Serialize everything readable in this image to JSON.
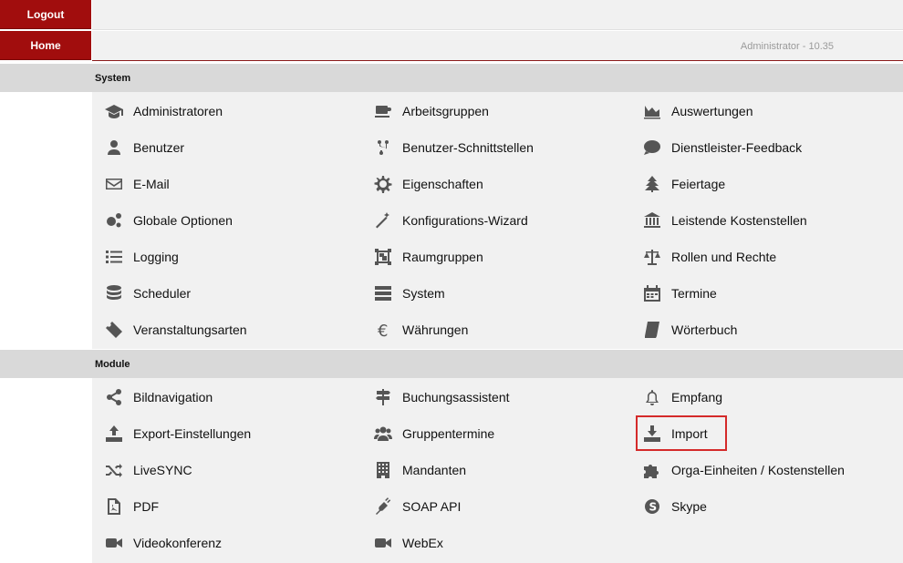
{
  "nav": {
    "logout": "Logout",
    "home": "Home"
  },
  "header": {
    "admin_info": "Administrator - 10.35"
  },
  "sections": {
    "system": {
      "title": "System",
      "items": [
        {
          "label": "Administratoren",
          "icon": "graduation-cap-icon"
        },
        {
          "label": "Arbeitsgruppen",
          "icon": "coffee-cup-icon"
        },
        {
          "label": "Auswertungen",
          "icon": "area-chart-icon"
        },
        {
          "label": "Benutzer",
          "icon": "user-icon"
        },
        {
          "label": "Benutzer-Schnittstellen",
          "icon": "code-fork-icon"
        },
        {
          "label": "Dienstleister-Feedback",
          "icon": "comment-dots-icon"
        },
        {
          "label": "E-Mail",
          "icon": "envelope-icon"
        },
        {
          "label": "Eigenschaften",
          "icon": "gear-icon"
        },
        {
          "label": "Feiertage",
          "icon": "tree-icon"
        },
        {
          "label": "Globale Optionen",
          "icon": "gears-icon"
        },
        {
          "label": "Konfigurations-Wizard",
          "icon": "magic-wand-icon"
        },
        {
          "label": "Leistende Kostenstellen",
          "icon": "bank-icon"
        },
        {
          "label": "Logging",
          "icon": "list-icon"
        },
        {
          "label": "Raumgruppen",
          "icon": "object-group-icon"
        },
        {
          "label": "Rollen und Rechte",
          "icon": "balance-scale-icon"
        },
        {
          "label": "Scheduler",
          "icon": "database-icon"
        },
        {
          "label": "System",
          "icon": "server-icon"
        },
        {
          "label": "Termine",
          "icon": "calendar-icon"
        },
        {
          "label": "Veranstaltungsarten",
          "icon": "ticket-icon"
        },
        {
          "label": "Währungen",
          "icon": "euro-icon"
        },
        {
          "label": "Wörterbuch",
          "icon": "book-icon"
        }
      ]
    },
    "module": {
      "title": "Module",
      "items": [
        {
          "label": "Bildnavigation",
          "icon": "share-nodes-icon"
        },
        {
          "label": "Buchungsassistent",
          "icon": "signpost-icon"
        },
        {
          "label": "Empfang",
          "icon": "bell-icon"
        },
        {
          "label": "Export-Einstellungen",
          "icon": "upload-icon"
        },
        {
          "label": "Gruppentermine",
          "icon": "users-icon"
        },
        {
          "label": "Import",
          "icon": "download-icon"
        },
        {
          "label": "LiveSYNC",
          "icon": "shuffle-icon"
        },
        {
          "label": "Mandanten",
          "icon": "building-icon"
        },
        {
          "label": "Orga-Einheiten / Kostenstellen",
          "icon": "puzzle-icon"
        },
        {
          "label": "PDF",
          "icon": "file-pdf-icon"
        },
        {
          "label": "SOAP API",
          "icon": "plug-icon"
        },
        {
          "label": "Skype",
          "icon": "skype-icon"
        },
        {
          "label": "Videokonferenz",
          "icon": "video-camera-icon"
        },
        {
          "label": "WebEx",
          "icon": "video-camera-icon"
        }
      ]
    }
  },
  "colors": {
    "brand": "#a10d0d",
    "highlight": "#d42a2a",
    "icon": "#555555",
    "section": "#d9d9d9",
    "panel": "#f1f1f1"
  }
}
